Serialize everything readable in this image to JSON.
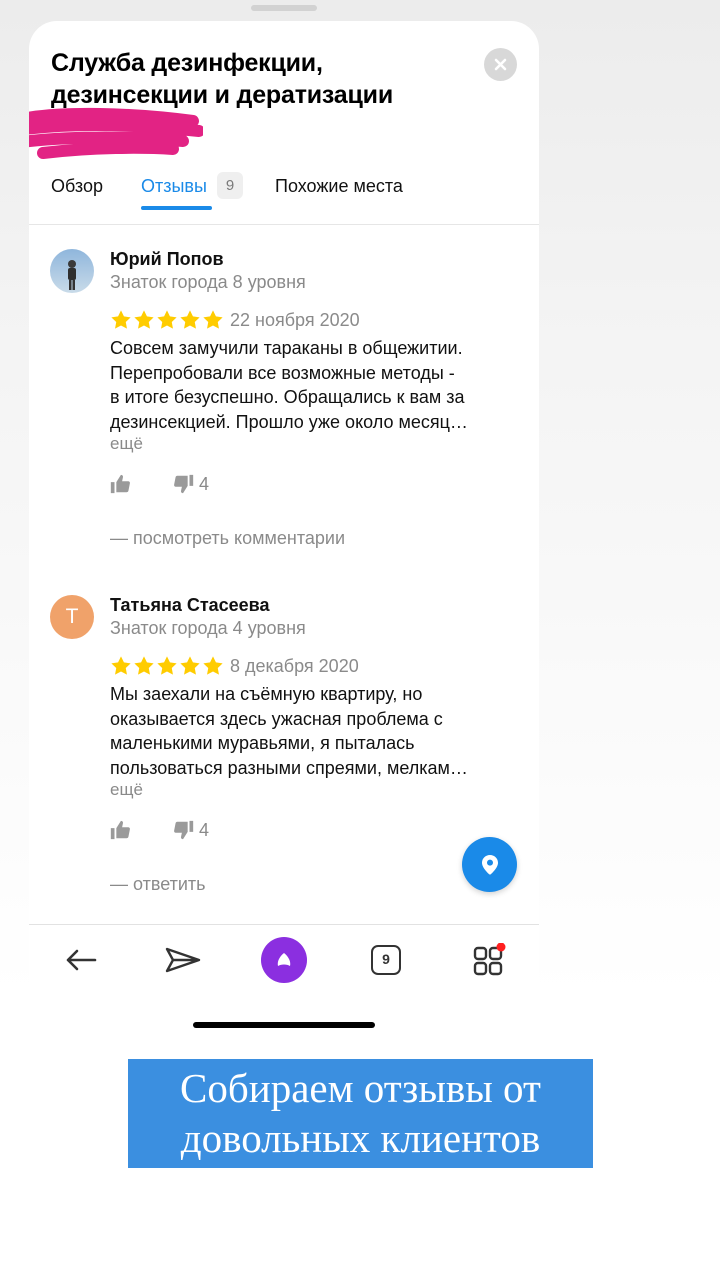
{
  "place": {
    "title_line1": "Служба дезинфекции,",
    "title_line2": "дезинсекции и дератизации"
  },
  "tabs": [
    {
      "label": "Обзор",
      "active": false
    },
    {
      "label": "Отзывы",
      "active": true,
      "badge": "9"
    },
    {
      "label": "Похожие места",
      "active": false
    }
  ],
  "reviews": [
    {
      "author": "Юрий Попов",
      "level": "Знаток города 8 уровня",
      "rating": 5,
      "date": "22 ноября 2020",
      "text_lines": [
        "Совсем замучили тараканы в общежитии.",
        "Перепробовали все возможные методы -",
        "в итоге безуспешно. Обращались к вам за",
        "дезинсекцией. Прошло уже около месяц…"
      ],
      "more_label": "ещё",
      "dislikes": "4",
      "link_label": "— посмотреть комментарии"
    },
    {
      "author": "Татьяна Стасеева",
      "avatar_letter": "Т",
      "level": "Знаток города 4 уровня",
      "rating": 5,
      "date": "8 декабря 2020",
      "text_lines": [
        "Мы заехали на съёмную квартиру, но",
        "оказывается здесь ужасная проблема с",
        "маленькими муравьями, я пыталась",
        "пользоваться разными спреями, мелкам…"
      ],
      "more_label": "ещё",
      "dislikes": "4",
      "link_label": "— ответить"
    }
  ],
  "bottom_nav": {
    "tabs_count": "9"
  },
  "caption": {
    "line1": "Собираем отзывы от",
    "line2": "довольных клиентов"
  },
  "colors": {
    "accent": "#1a8ae8",
    "star": "#ffcc00",
    "alice": "#8b2fe0",
    "caption_bg": "#3b8fe0",
    "scribble": "#e0177d"
  },
  "icons": [
    "close-icon",
    "thumb-up-icon",
    "thumb-down-icon",
    "location-pin-icon",
    "back-arrow-icon",
    "share-icon",
    "alice-icon",
    "tabs-icon",
    "services-grid-icon"
  ]
}
